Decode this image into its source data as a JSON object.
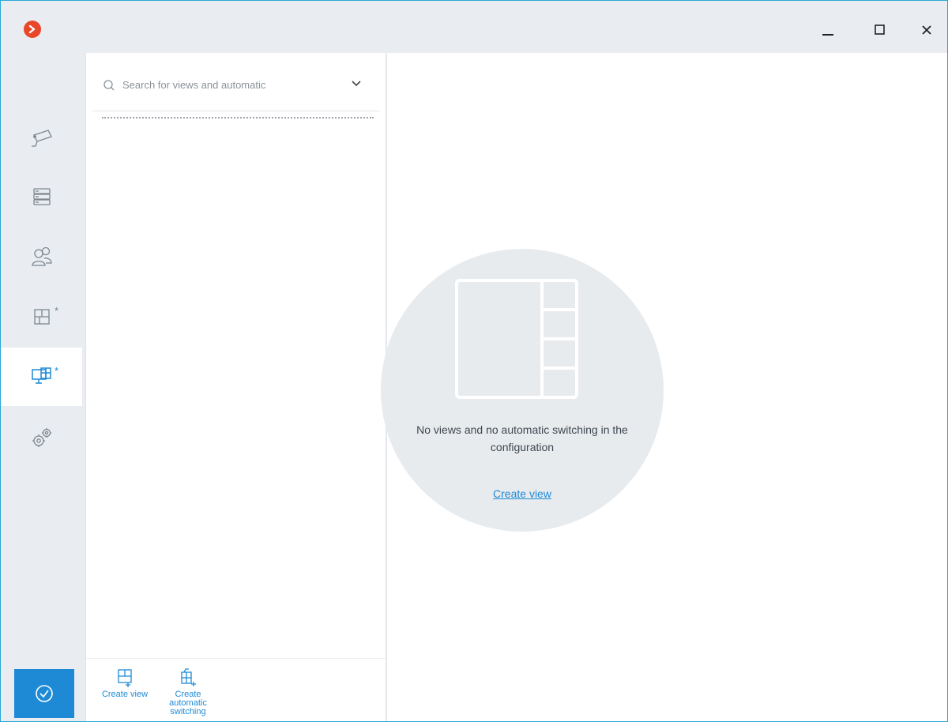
{
  "window": {
    "logo_icon": "app-logo-icon",
    "controls": {
      "minimize_icon": "minimize-icon",
      "maximize_icon": "maximize-icon",
      "close_icon": "close-icon"
    }
  },
  "rail": {
    "items": [
      {
        "icon": "camera-icon",
        "active": false,
        "modified": false
      },
      {
        "icon": "server-icon",
        "active": false,
        "modified": false
      },
      {
        "icon": "users-icon",
        "active": false,
        "modified": false
      },
      {
        "icon": "map-layout-icon",
        "active": false,
        "modified": true
      },
      {
        "icon": "views-monitor-icon",
        "active": true,
        "modified": true
      },
      {
        "icon": "settings-gears-icon",
        "active": false,
        "modified": false
      }
    ],
    "modified_marker": "*",
    "apply_icon": "check-circle-icon",
    "accent_color": "#1e8ad6"
  },
  "search": {
    "placeholder": "Search for views and automatic",
    "value": ""
  },
  "bottom_bar": {
    "create_view_label": "Create view",
    "create_switching_label": "Create automatic switching"
  },
  "empty_state": {
    "message": "No views and no automatic switching in the configuration",
    "link": "Create view"
  }
}
